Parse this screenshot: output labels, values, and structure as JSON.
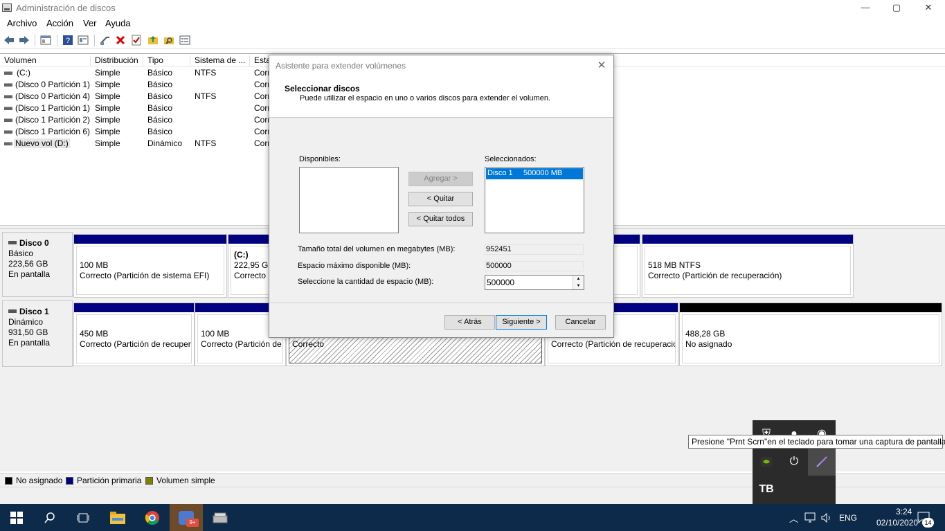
{
  "window": {
    "title": "Administración de discos",
    "min": "—",
    "max": "▢",
    "close": "✕"
  },
  "menu": [
    "Archivo",
    "Acción",
    "Ver",
    "Ayuda"
  ],
  "volume_table": {
    "columns": [
      "Volumen",
      "Distribución",
      "Tipo",
      "Sistema de ...",
      "Esta"
    ],
    "rows": [
      [
        "(C:)",
        "Simple",
        "Básico",
        "NTFS",
        "Corr"
      ],
      [
        "(Disco 0 Partición 1)",
        "Simple",
        "Básico",
        "",
        "Corr"
      ],
      [
        "(Disco 0 Partición 4)",
        "Simple",
        "Básico",
        "NTFS",
        "Corr"
      ],
      [
        "(Disco 1 Partición 1)",
        "Simple",
        "Básico",
        "",
        "Corr"
      ],
      [
        "(Disco 1 Partición 2)",
        "Simple",
        "Básico",
        "",
        "Corr"
      ],
      [
        "(Disco 1 Partición 6)",
        "Simple",
        "Básico",
        "",
        "Corr"
      ],
      [
        "Nuevo vol (D:)",
        "Simple",
        "Dinámico",
        "NTFS",
        "Corr"
      ]
    ]
  },
  "disks": [
    {
      "name": "Disco 0",
      "type": "Básico",
      "size": "223,56 GB",
      "status": "En pantalla",
      "partitions": [
        {
          "line1": "100 MB",
          "line2": "Correcto (Partición de sistema EFI)"
        },
        {
          "title": "(C:)",
          "line1": "222,95 GB",
          "line2": "Correcto"
        },
        {
          "line1": "518 MB NTFS",
          "line2": "Correcto (Partición de recuperación)"
        }
      ]
    },
    {
      "name": "Disco 1",
      "type": "Dinámico",
      "size": "931,50 GB",
      "status": "En pantalla",
      "partitions": [
        {
          "line1": "450 MB",
          "line2": "Correcto (Partición de recuper"
        },
        {
          "line1": "100 MB",
          "line2": "Correcto (Partición de"
        },
        {
          "line2": "Correcto"
        },
        {
          "line2": "Correcto (Partición de recuperació"
        },
        {
          "line1": "488,28 GB",
          "line2": "No asignado"
        }
      ]
    }
  ],
  "legend": [
    {
      "label": "No asignado",
      "color": "#000000"
    },
    {
      "label": "Partición primaria",
      "color": "#000080"
    },
    {
      "label": "Volumen simple",
      "color": "#808000"
    }
  ],
  "dialog": {
    "title": "Asistente para extender volúmenes",
    "heading": "Seleccionar discos",
    "subheading": "Puede utilizar el espacio en uno o varios discos para extender el volumen.",
    "available_label": "Disponibles:",
    "selected_label": "Seleccionados:",
    "selected_items": [
      "Disco 1     500000 MB"
    ],
    "add_button": "Agregar >",
    "remove_button": "< Quitar",
    "remove_all_button": "< Quitar todos",
    "total_label": "Tamaño total del volumen en megabytes (MB):",
    "total_value": "952451",
    "max_label": "Espacio máximo disponible (MB):",
    "max_value": "500000",
    "amount_label": "Seleccione la cantidad de espacio (MB):",
    "amount_value": "500000",
    "back_button": "< Atrás",
    "next_button": "Siguiente >",
    "cancel_button": "Cancelar"
  },
  "tooltip": "Presione \"Prnt Scrn\"en el teclado para tomar una captura de pantalla",
  "taskbar": {
    "language": "ENG",
    "time": "3:24",
    "date": "02/10/2020",
    "notifications": "14",
    "badge": "9+"
  }
}
